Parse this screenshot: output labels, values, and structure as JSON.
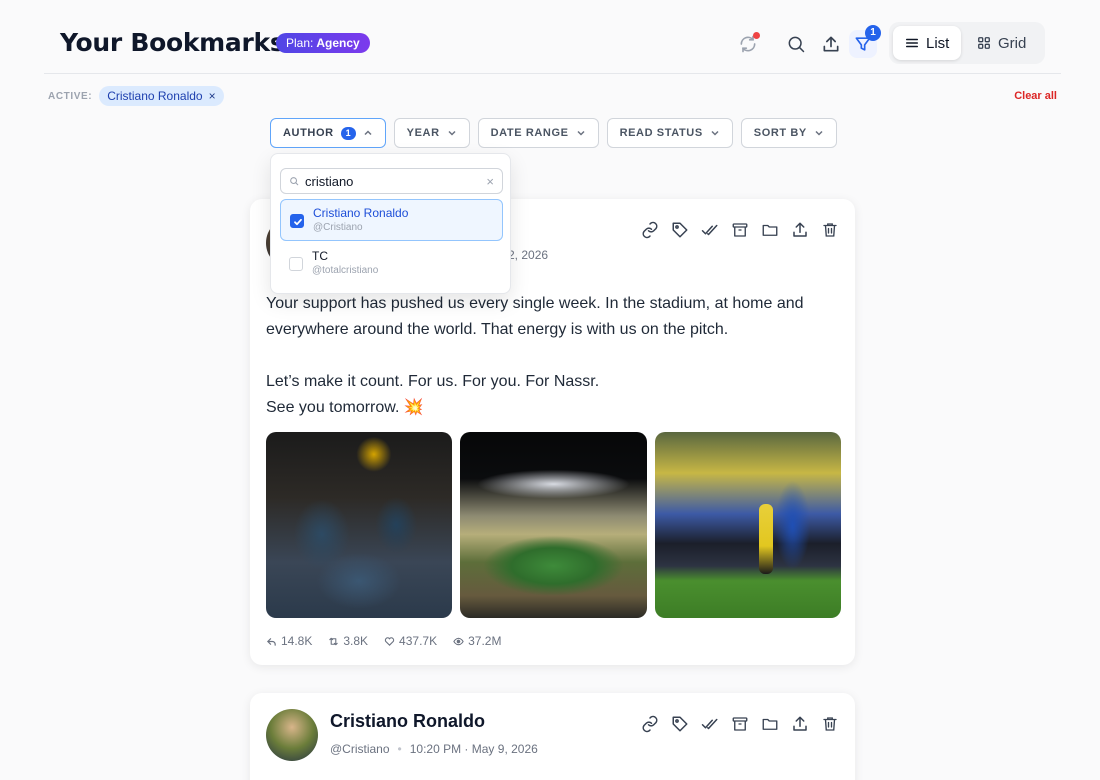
{
  "header": {
    "title": "Your Bookmarks",
    "plan_label": "Plan:",
    "plan_name": "Agency",
    "filter_count": "1",
    "view_list": "List",
    "view_grid": "Grid"
  },
  "active_filters": {
    "label": "ACTIVE:",
    "chips": [
      "Cristiano Ronaldo"
    ],
    "clear_all": "Clear all"
  },
  "filters": {
    "author": "AUTHOR",
    "author_count": "1",
    "year": "YEAR",
    "date_range": "DATE RANGE",
    "read_status": "READ STATUS",
    "sort_by": "SORT BY"
  },
  "author_dropdown": {
    "search_value": "cristiano",
    "options": [
      {
        "name": "Cristiano Ronaldo",
        "handle": "@Cristiano",
        "selected": true
      },
      {
        "name": "TC",
        "handle": "@totalcristiano",
        "selected": false
      }
    ]
  },
  "posts": [
    {
      "date_fragment": "2, 2026",
      "text_lines": [
        "Your support has pushed us every single week. In the stadium, at home and everywhere around the world. That energy is with us on the pitch.",
        "Let’s make it count. For us. For you. For Nassr.",
        "See you tomorrow. 💥"
      ],
      "stats": {
        "replies": "14.8K",
        "retweets": "3.8K",
        "likes": "437.7K",
        "views": "37.2M"
      }
    },
    {
      "author": "Cristiano Ronaldo",
      "handle": "@Cristiano",
      "time": "10:20 PM · May 9, 2026"
    }
  ],
  "icons": {
    "header": [
      "sync-icon",
      "search-icon",
      "upload-icon",
      "filter-icon",
      "list-icon",
      "grid-icon"
    ],
    "card_actions": [
      "link-icon",
      "tag-icon",
      "double-check-icon",
      "archive-icon",
      "folder-icon",
      "share-icon",
      "trash-icon"
    ]
  },
  "colors": {
    "accent": "#2563eb",
    "plan_badge": "#6d28d9",
    "clear_all": "#dc2626"
  }
}
